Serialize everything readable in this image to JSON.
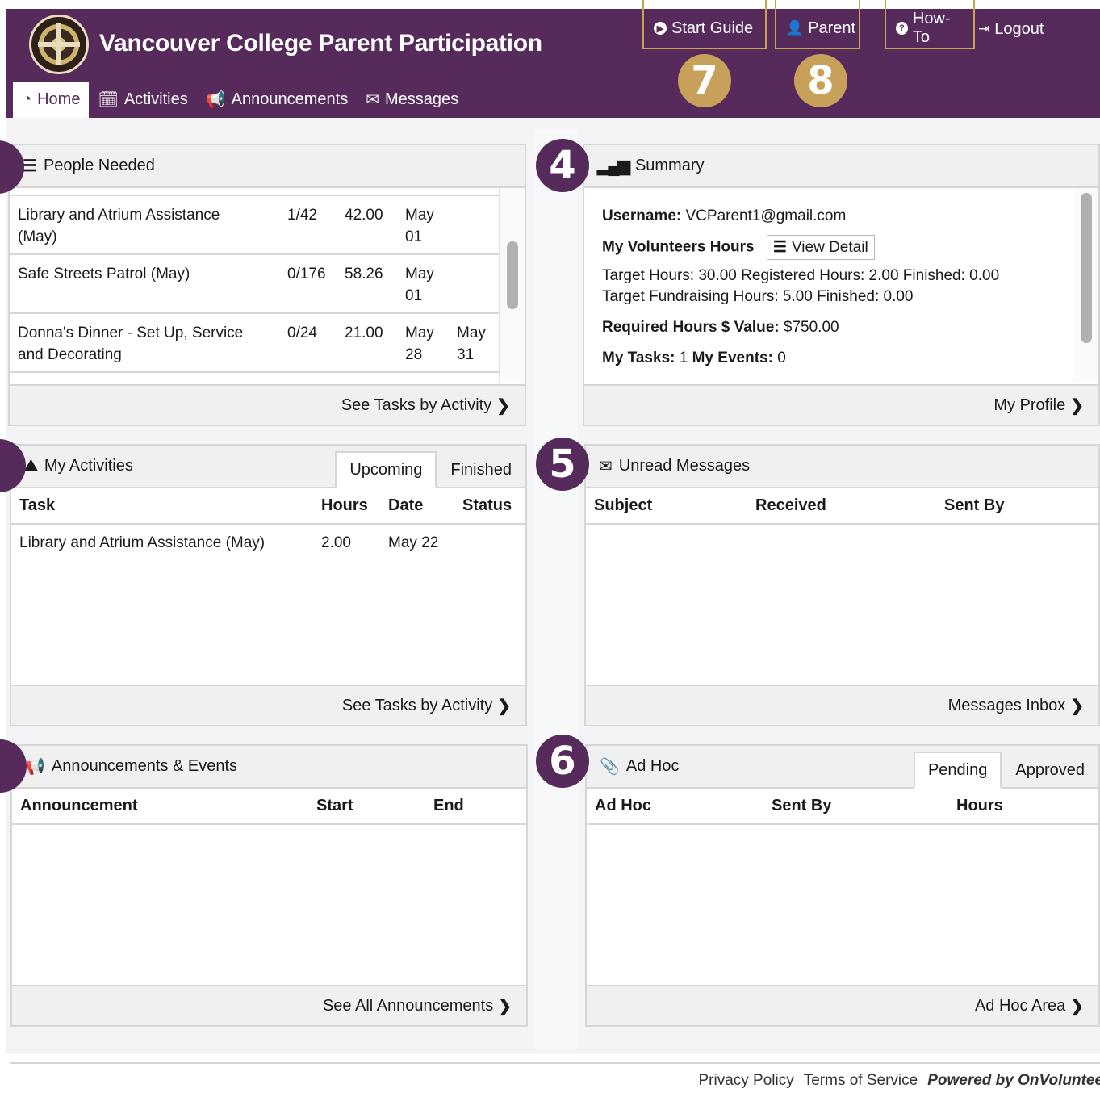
{
  "header": {
    "title": "Vancouver College Parent Participation",
    "start_guide": "Start Guide",
    "parent": "Parent",
    "how_to": "How-To",
    "logout": "Logout",
    "callout_7": "7",
    "callout_8": "8"
  },
  "nav": {
    "home": "Home",
    "activities": "Activities",
    "announcements": "Announcements",
    "messages": "Messages"
  },
  "people_needed": {
    "title": "People Needed",
    "rows": [
      {
        "name": "Library and Atrium Assistance (May)",
        "slots": "1/42",
        "hours": "42.00",
        "start": "May 01",
        "end": ""
      },
      {
        "name": "Safe Streets Patrol (May)",
        "slots": "0/176",
        "hours": "58.26",
        "start": "May 01",
        "end": ""
      },
      {
        "name": "Donna's Dinner - Set Up, Service and Decorating",
        "slots": "0/24",
        "hours": "21.00",
        "start": "May 28",
        "end": "May 31"
      }
    ],
    "footer": "See Tasks by Activity"
  },
  "summary": {
    "callout": "4",
    "title": "Summary",
    "username_label": "Username:",
    "username_value": "VCParent1@gmail.com",
    "volunteer_hours_label": "My Volunteers Hours",
    "view_detail": "View Detail",
    "target_line": "Target Hours: 30.00 Registered Hours: 2.00 Finished: 0.00",
    "fundraising_line": "Target Fundraising Hours: 5.00 Finished: 0.00",
    "required_label": "Required Hours $ Value:",
    "required_value": "$750.00",
    "tasks_label": "My Tasks:",
    "tasks_value": "1",
    "events_label": "My Events:",
    "events_value": "0",
    "footer": "My Profile"
  },
  "my_activities": {
    "title": "My Activities",
    "tab_upcoming": "Upcoming",
    "tab_finished": "Finished",
    "columns": {
      "task": "Task",
      "hours": "Hours",
      "date": "Date",
      "status": "Status"
    },
    "rows": [
      {
        "task": "Library and Atrium Assistance (May)",
        "hours": "2.00",
        "date": "May 22",
        "status": ""
      }
    ],
    "footer": "See Tasks by Activity"
  },
  "unread_messages": {
    "callout": "5",
    "title": "Unread Messages",
    "columns": {
      "subject": "Subject",
      "received": "Received",
      "sent_by": "Sent By"
    },
    "footer": "Messages Inbox"
  },
  "announcements": {
    "title": "Announcements & Events",
    "columns": {
      "announcement": "Announcement",
      "start": "Start",
      "end": "End"
    },
    "footer": "See All Announcements"
  },
  "ad_hoc": {
    "callout": "6",
    "title": "Ad Hoc",
    "tab_pending": "Pending",
    "tab_approved": "Approved",
    "columns": {
      "ad_hoc": "Ad Hoc",
      "sent_by": "Sent By",
      "hours": "Hours"
    },
    "footer": "Ad Hoc Area"
  },
  "footer": {
    "privacy": "Privacy Policy",
    "terms": "Terms of Service",
    "powered": "Powered by OnVolunteers"
  },
  "colors": {
    "brand": "#562a5a",
    "callout_gold": "#c7a05a"
  }
}
